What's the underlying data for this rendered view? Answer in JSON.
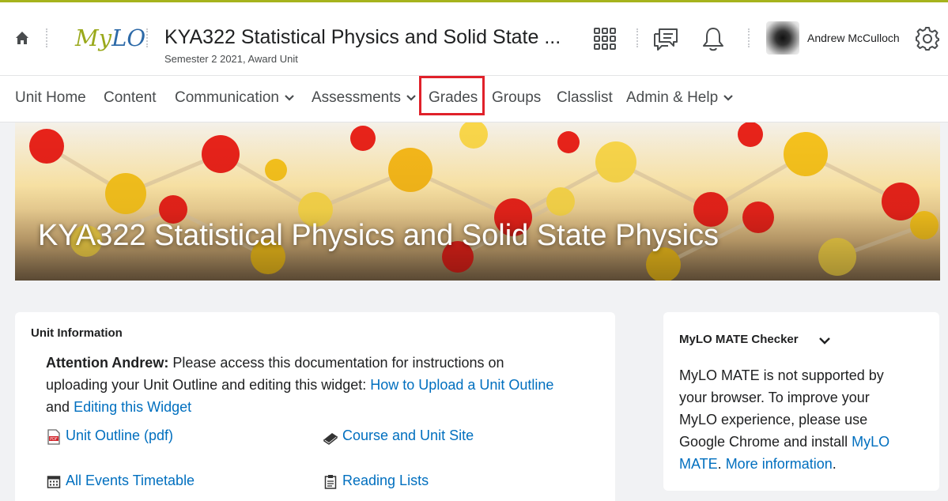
{
  "header": {
    "logo_part1": "My",
    "logo_part2": "LO",
    "unit_title": "KYA322 Statistical Physics and Solid State ...",
    "unit_subtitle": "Semester 2 2021, Award Unit",
    "user_name": "Andrew McCulloch",
    "icons": [
      "home-icon",
      "waffle-grid-icon",
      "message-icon",
      "bell-icon",
      "gear-icon"
    ]
  },
  "nav": {
    "items": [
      {
        "label": "Unit Home"
      },
      {
        "label": "Content"
      },
      {
        "label": "Communication"
      },
      {
        "label": "Assessments"
      },
      {
        "label": "Grades"
      },
      {
        "label": "Groups"
      },
      {
        "label": "Classlist"
      },
      {
        "label": "Admin & Help"
      }
    ],
    "highlight_color": "#e0212a"
  },
  "banner": {
    "title": "KYA322 Statistical Physics and Solid State Physics"
  },
  "unit_info": {
    "heading": "Unit Information",
    "attention_name": "Attention Andrew:",
    "attention_text1": "Please access this documentation for instructions on",
    "attention_text2": "uploading your Unit Outline and editing this widget:",
    "link_upload": "How to Upload a Unit Outline",
    "and_text": "and",
    "link_edit": "Editing this Widget",
    "links": [
      {
        "label": "Unit Outline (pdf)",
        "icon": "pdf-icon"
      },
      {
        "label": "Course and Unit Site",
        "icon": "book-icon"
      },
      {
        "label": "All Events Timetable",
        "icon": "calendar-icon"
      },
      {
        "label": "Reading Lists",
        "icon": "clipboard-icon"
      }
    ]
  },
  "mate_checker": {
    "heading": "MyLO MATE Checker",
    "line1": "MyLO MATE is not supported by",
    "line2": "your browser. To improve your",
    "line3": "MyLO experience, please use",
    "line4_text": "Google Chrome and install",
    "link_mylo": "MyLO",
    "link_mate": "MATE",
    "link_more": "More information"
  },
  "colors": {
    "accent": "#a6b31d",
    "link": "#006fbf",
    "background": "#f1f2f4"
  }
}
